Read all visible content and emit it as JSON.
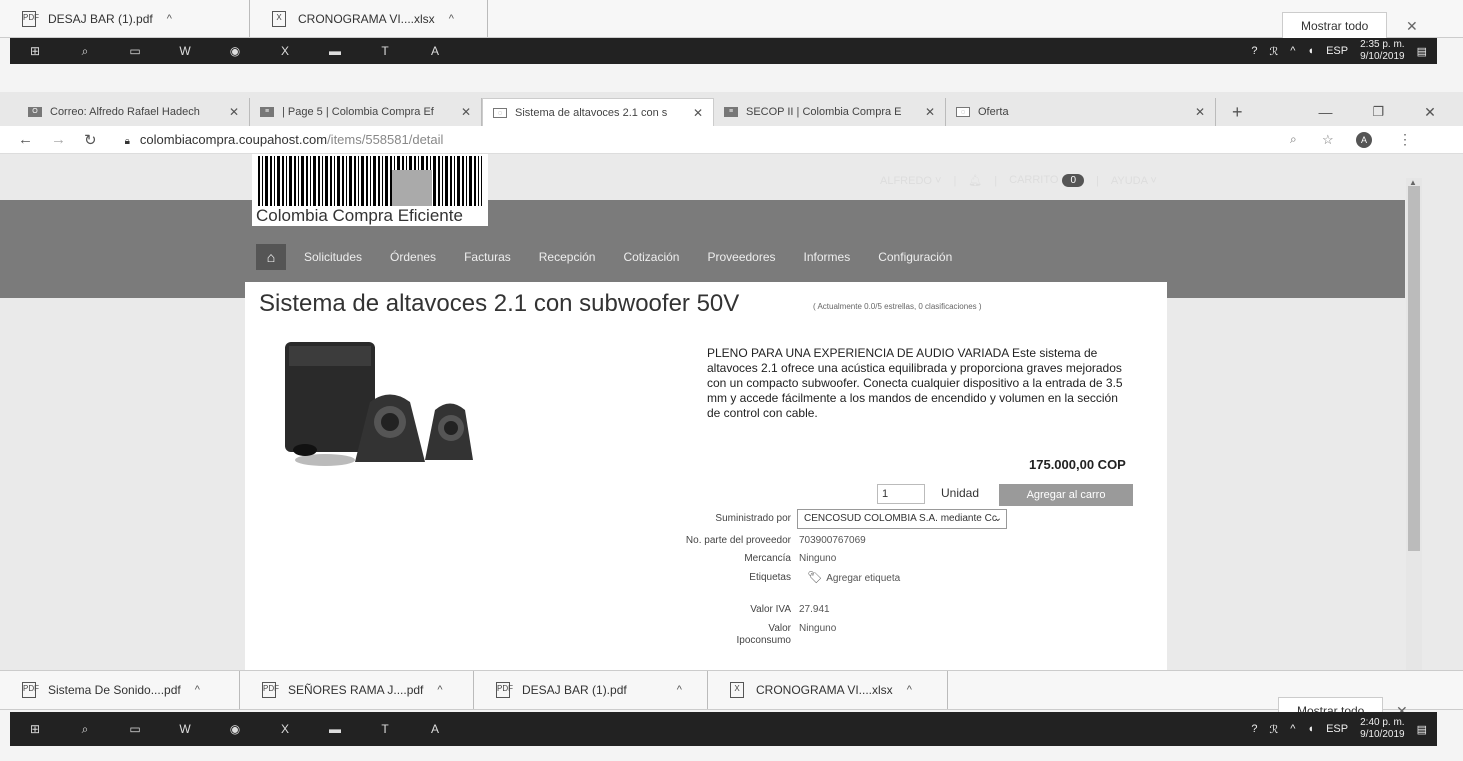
{
  "top_downloads": {
    "items": [
      {
        "name": "DESAJ BAR (1).pdf",
        "icon": "pdf-icon"
      },
      {
        "name": "CRONOGRAMA VI....xlsx",
        "icon": "excel-icon"
      }
    ],
    "show_all": "Mostrar todo"
  },
  "top_taskbar": {
    "lang": "ESP",
    "time": "2:35 p. m.",
    "date": "9/10/2019"
  },
  "browser": {
    "tabs": [
      {
        "title": "Correo: Alfredo Rafael Hadech",
        "fav": "O"
      },
      {
        "title": "| Page 5 | Colombia Compra Ef",
        "fav": "≡"
      },
      {
        "title": "Sistema de altavoces 2.1 con s",
        "fav": "◌",
        "active": true
      },
      {
        "title": "SECOP II | Colombia Compra E",
        "fav": "≡"
      },
      {
        "title": "Oferta",
        "fav": "◌"
      }
    ],
    "url_host": "colombiacompra.coupahost.com",
    "url_path": "/items/558581/detail"
  },
  "site": {
    "logo_text": "Colombia Compra Eficiente",
    "user": "ALFREDO ˅",
    "cart_label": "CARRITO",
    "cart_count": "0",
    "help": "AYUDA ˅",
    "nav": [
      "Solicitudes",
      "Órdenes",
      "Facturas",
      "Recepción",
      "Cotización",
      "Proveedores",
      "Informes",
      "Configuración"
    ]
  },
  "product": {
    "title": "Sistema de altavoces 2.1 con subwoofer 50V",
    "rating": "( Actualmente 0.0/5 estrellas, 0 clasificaciones )",
    "description": "PLENO PARA UNA EXPERIENCIA DE AUDIO VARIADA Este sistema de altavoces 2.1 ofrece una acústica equilibrada y proporciona graves mejorados con un compacto subwoofer. Conecta cualquier dispositivo a la entrada de 3.5 mm y accede fácilmente a los mandos de encendido y volumen en la sección de control con cable.",
    "price": "175.000,00 COP",
    "qty": "1",
    "unit": "Unidad",
    "add_to_cart": "Agregar al carro",
    "supplied_by_label": "Suministrado por",
    "supplier": "CENCOSUD COLOMBIA S.A. mediante Cc",
    "part_label": "No. parte del proveedor",
    "part_value": "703900767069",
    "merch_label": "Mercancía",
    "merch_value": "Ninguno",
    "tags_label": "Etiquetas",
    "tags_value": "Agregar etiqueta",
    "iva_label": "Valor IVA",
    "iva_value": "27.941",
    "ipo_label1": "Valor",
    "ipo_label2": "Ipoconsumo",
    "ipo_value": "Ninguno"
  },
  "bottom_downloads": {
    "items": [
      {
        "name": "Sistema De Sonido....pdf",
        "icon": "pdf-icon"
      },
      {
        "name": "SEÑORES RAMA J....pdf",
        "icon": "pdf-icon"
      },
      {
        "name": "DESAJ BAR (1).pdf",
        "icon": "pdf-icon"
      },
      {
        "name": "CRONOGRAMA VI....xlsx",
        "icon": "excel-icon"
      }
    ],
    "show_all": "Mostrar todo"
  },
  "bottom_taskbar": {
    "lang": "ESP",
    "time": "2:40 p. m.",
    "date": "9/10/2019"
  }
}
